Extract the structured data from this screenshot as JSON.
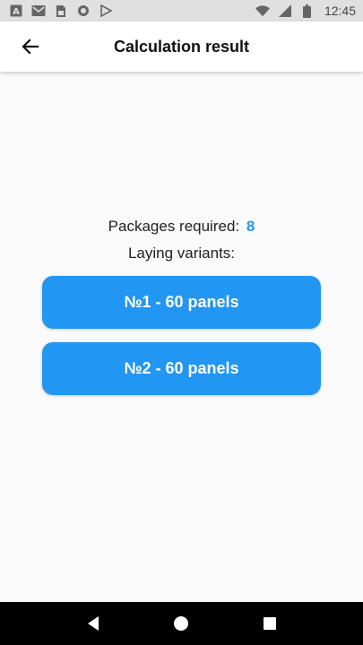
{
  "status_bar": {
    "time": "12:45",
    "left_icons": [
      "a-letter-icon",
      "gmail-icon",
      "sim-card-icon",
      "record-icon",
      "play-store-icon"
    ],
    "right_icons": [
      "wifi-icon",
      "cellular-icon",
      "battery-icon"
    ]
  },
  "app_bar": {
    "title": "Calculation result",
    "back_icon": "arrow-back-icon"
  },
  "result": {
    "packages_label": "Packages required:",
    "packages_value": "8",
    "laying_label": "Laying variants:"
  },
  "variants": [
    {
      "label": "№1 - 60 panels"
    },
    {
      "label": "№2 - 60 panels"
    }
  ],
  "nav_bar": {
    "buttons": [
      "back-triangle-icon",
      "home-circle-icon",
      "recents-square-icon"
    ]
  },
  "colors": {
    "accent": "#2196f3",
    "background": "#fafafa",
    "status_bar": "#e0e0e0",
    "nav_bar": "#000000"
  }
}
